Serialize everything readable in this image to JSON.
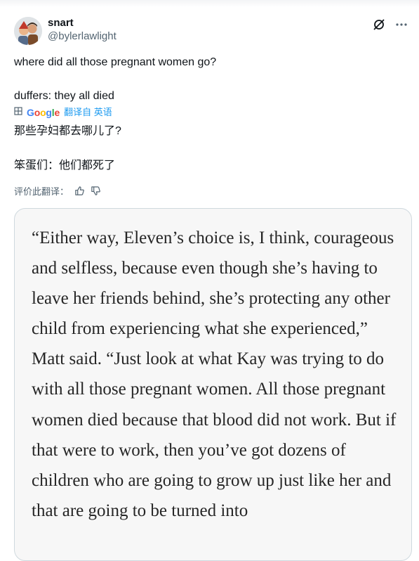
{
  "author": {
    "display_name": "snart",
    "handle": "@bylerlawlight",
    "avatar_icon": "avatar-illustration"
  },
  "header_icons": {
    "grok": "grok-icon",
    "more": "more-icon"
  },
  "tweet": {
    "line1": "where did all those pregnant women go?",
    "line2": "duffers: they all died"
  },
  "translation": {
    "provider": "Google",
    "label": "翻译自 英语",
    "line1": "那些孕妇都去哪儿了?",
    "line2": "笨蛋们：他们都死了",
    "rate_label": "评价此翻译："
  },
  "media": {
    "quote_text": "“Either way, Eleven’s choice is, I think, courageous and selfless, because even though she’s having to leave her friends behind, she’s protecting any other child from experiencing what she experienced,” Matt said. “Just look at what Kay was trying to do with all those pregnant women. All those pregnant women died because that blood did not work. But if that were to work, then you’ve got dozens of children who are going to grow up just like her and that are going to be turned into"
  },
  "colors": {
    "link_blue": "#1d9bf0",
    "secondary_text": "#536471",
    "card_bg": "#f7f7f7",
    "card_border": "#cfd9de"
  }
}
